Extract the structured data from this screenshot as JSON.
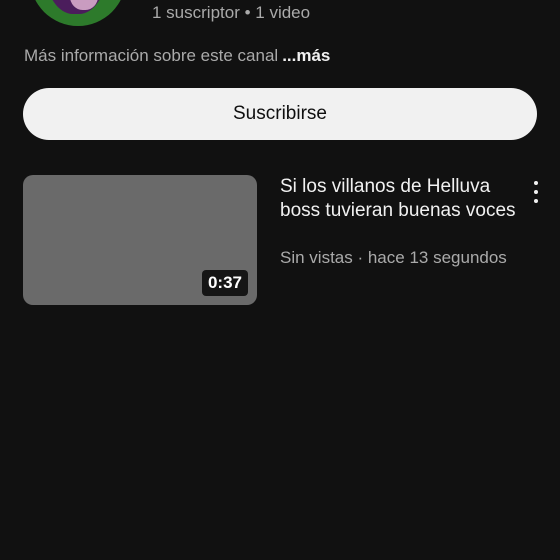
{
  "channel": {
    "stats": "1 suscriptor • 1 video",
    "description": "Más información sobre este canal",
    "more_label": "...más"
  },
  "subscribe": {
    "label": "Suscribirse"
  },
  "videos": [
    {
      "title": "Si los villanos de Helluva boss tuvieran buenas voces",
      "views": "Sin vistas",
      "separator": "·",
      "age": "hace 13 segundos",
      "meta": "Sin vistas · hace 13 segundos",
      "duration": "0:37",
      "menu_icon": "more-vert-icon"
    }
  ],
  "colors": {
    "background": "#111111",
    "text_primary": "#f1f1f1",
    "text_secondary": "#aaaaaa",
    "button_bg": "#f1f1f1",
    "thumbnail_placeholder": "#6a6a6a",
    "avatar_bg": "#2d7a2b"
  }
}
